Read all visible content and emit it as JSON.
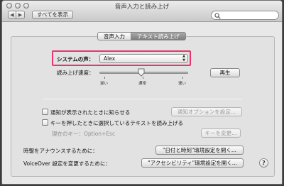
{
  "window": {
    "title": "音声入力と読み上げ"
  },
  "toolbar": {
    "show_all_label": "すべてを表示",
    "back_glyph": "◀",
    "forward_glyph": "▶",
    "search_value": ""
  },
  "tabs": [
    {
      "label": "音声入力"
    },
    {
      "label": "テキスト読み上げ",
      "selected": true
    }
  ],
  "voice": {
    "label": "システムの声：",
    "value": "Alex"
  },
  "rate": {
    "label": "読み上げ速度：",
    "tick_labels": [
      "遅い",
      "通常",
      "速い"
    ],
    "level": 0.47,
    "play_button": "再生"
  },
  "options": {
    "alert": {
      "label": "通知が表示されたときに知らせる",
      "checked": false,
      "button": "通知オプションを設定..."
    },
    "speak_selected": {
      "label": "キーを押したときに選択しているテキストを読み上げる",
      "checked": false
    },
    "current_key": "現在のキー：Option+Esc",
    "change_key_button": "キーを変更..."
  },
  "clock": {
    "label": "時報をアナウンスするために：",
    "button": "\"日付と時刻\"環境設定を開く..."
  },
  "voiceover": {
    "label": "VoiceOver 設定を変更するために：",
    "button": "\"アクセシビリティ\"環境設定を開く..."
  },
  "help": {
    "glyph": "?"
  },
  "colors": {
    "highlight": "#e8356d",
    "selected_tab": "#8a8a8a"
  }
}
